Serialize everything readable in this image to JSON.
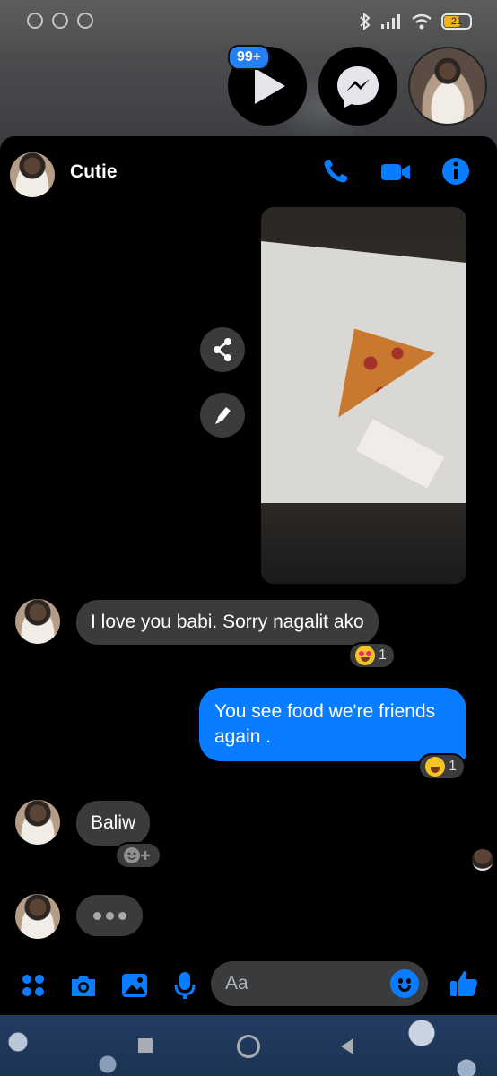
{
  "status_bar": {
    "battery": "21"
  },
  "chat_heads": {
    "badge": "99+"
  },
  "header": {
    "title": "Cutie"
  },
  "messages": {
    "m1": "I love you babi. Sorry nagalit ako",
    "m1_reaction_count": "1",
    "m2": "You see food we're friends again .",
    "m2_reaction_count": "1",
    "m3": "Baliw"
  },
  "composer": {
    "placeholder": "Aa"
  },
  "colors": {
    "accent": "#0a7cff",
    "bubble_in": "#3a3b3c",
    "background": "#000000"
  },
  "icons": [
    "phone-icon",
    "video-icon",
    "info-icon",
    "share-icon",
    "edit-icon",
    "apps-icon",
    "camera-icon",
    "gallery-icon",
    "mic-icon",
    "emoji-icon",
    "like-icon"
  ]
}
